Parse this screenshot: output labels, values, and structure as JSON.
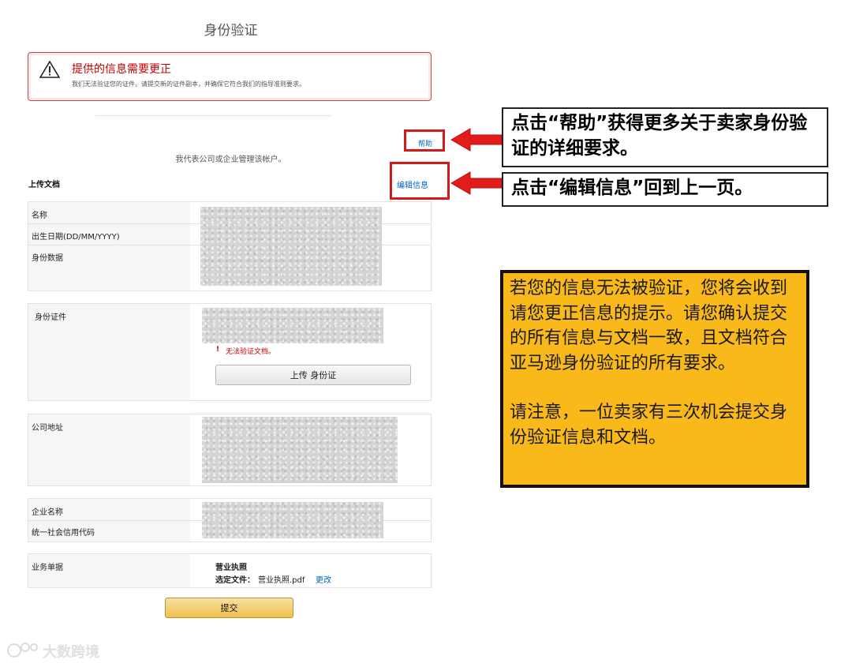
{
  "page": {
    "title": "身份验证"
  },
  "alert": {
    "title": "提供的信息需要更正",
    "message": "我们无法验证您的证件。请提交新的证件副本，并确保它符合我们的指导准则要求。"
  },
  "links": {
    "help": "帮助",
    "edit_info": "编辑信息"
  },
  "represent_text": "我代表公司或企业管理该帐户。",
  "upload_docs_heading": "上传文档",
  "personal_section": {
    "rows": [
      "名称",
      "出生日期(DD/MM/YYYY)",
      "身份数据"
    ]
  },
  "id_section": {
    "label": "身份证件",
    "error": "无法验证文档。",
    "error_mark": "!",
    "upload_button": "上传 身份证"
  },
  "address_section": {
    "label": "公司地址"
  },
  "business_section": {
    "rows": [
      "企业名称",
      "统一社会信用代码"
    ]
  },
  "documents_section": {
    "label": "业务单据",
    "doc_title": "营业执照",
    "selected_label": "选定文件：",
    "file_name": "营业执照.pdf",
    "change_link": "更改"
  },
  "submit_button": "提交",
  "callouts": {
    "help": "点击“帮助”获得更多关于卖家身份验证的详细要求。",
    "edit": "点击“编辑信息”回到上一页。"
  },
  "note": {
    "paragraph1": "若您的信息无法被验证，您将会收到请您更正信息的提示。请您确认提交的所有信息与文档一致，且文档符合亚马逊身份验证的所有要求。",
    "paragraph2": "请注意，一位卖家有三次机会提交身份验证信息和文档。"
  },
  "watermark": "大数跨境",
  "colors": {
    "alert_red": "#c40000",
    "annotation_red": "#d11a1a",
    "link_blue": "#0066c0",
    "note_yellow": "#f9b91a",
    "submit_yellow": "#f0c14b"
  },
  "icons": {
    "alert": "warning-triangle-icon",
    "arrow": "red-arrow-icon"
  }
}
